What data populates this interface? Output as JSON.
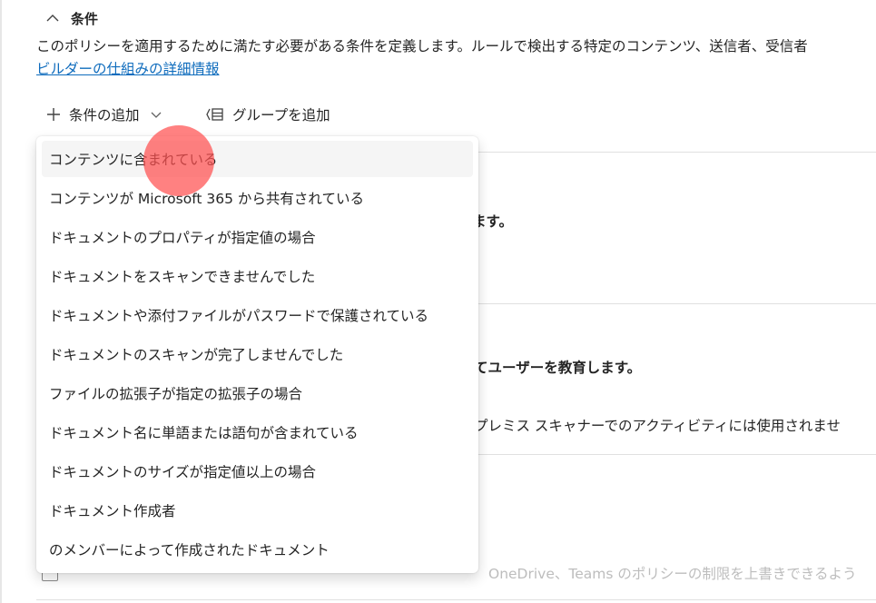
{
  "section": {
    "title": "条件",
    "description": "このポリシーを適用するために満たす必要がある条件を定義します。ルールで検出する特定のコンテンツ、送信者、受信者",
    "learn_more": "ビルダーの仕組みの詳細情報"
  },
  "toolbar": {
    "add_condition": "条件の追加",
    "add_group": "グループを追加"
  },
  "background": {
    "line1_fragment": "ます。",
    "line2_fragment": "てユーザーを教育します。",
    "line3_fragment": "プレミス スキャナーでのアクティビティには使用されませ",
    "line4_fragment": "OneDrive、Teams のポリシーの制限を上書きできるよう"
  },
  "menu": {
    "items": [
      "コンテンツに含まれている",
      "コンテンツが Microsoft 365 から共有されている",
      "ドキュメントのプロパティが指定値の場合",
      "ドキュメントをスキャンできませんでした",
      "ドキュメントや添付ファイルがパスワードで保護されている",
      "ドキュメントのスキャンが完了しませんでした",
      "ファイルの拡張子が指定の拡張子の場合",
      "ドキュメント名に単語または語句が含まれている",
      "ドキュメントのサイズが指定値以上の場合",
      "ドキュメント作成者",
      "のメンバーによって作成されたドキュメント"
    ],
    "hovered_index": 0
  },
  "colors": {
    "link": "#0f6cbd",
    "hover": "#f5f5f5",
    "click_marker": "#ff5050"
  }
}
